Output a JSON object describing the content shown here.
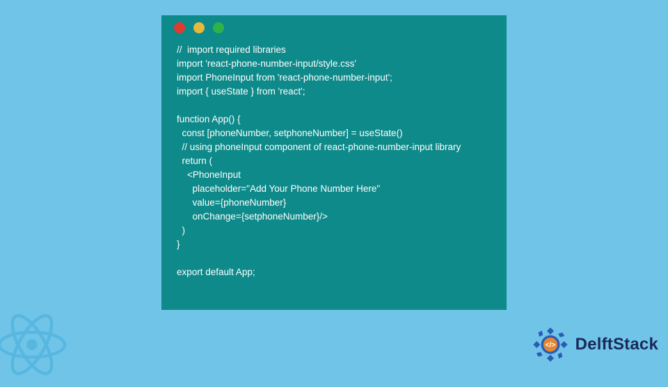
{
  "window": {
    "dots": [
      "red",
      "yellow",
      "green"
    ]
  },
  "code": {
    "lines": [
      "//  import required libraries",
      "import 'react-phone-number-input/style.css'",
      "import PhoneInput from 'react-phone-number-input';",
      "import { useState } from 'react';",
      "",
      "function App() {",
      "  const [phoneNumber, setphoneNumber] = useState()",
      "  // using phoneInput component of react-phone-number-input library",
      "  return (",
      "    <PhoneInput",
      "      placeholder=\"Add Your Phone Number Here\"",
      "      value={phoneNumber}",
      "      onChange={setphoneNumber}/>",
      "  )",
      "}",
      "",
      "export default App;"
    ]
  },
  "brand": {
    "name": "DelftStack"
  },
  "colors": {
    "background": "#6fc4e8",
    "window": "#0e8a8a",
    "watermark": "#3ea9d8",
    "brandText": "#1a2a5a",
    "brandLogoOuter": "#2c5bb5",
    "brandLogoInner": "#e5872f"
  }
}
